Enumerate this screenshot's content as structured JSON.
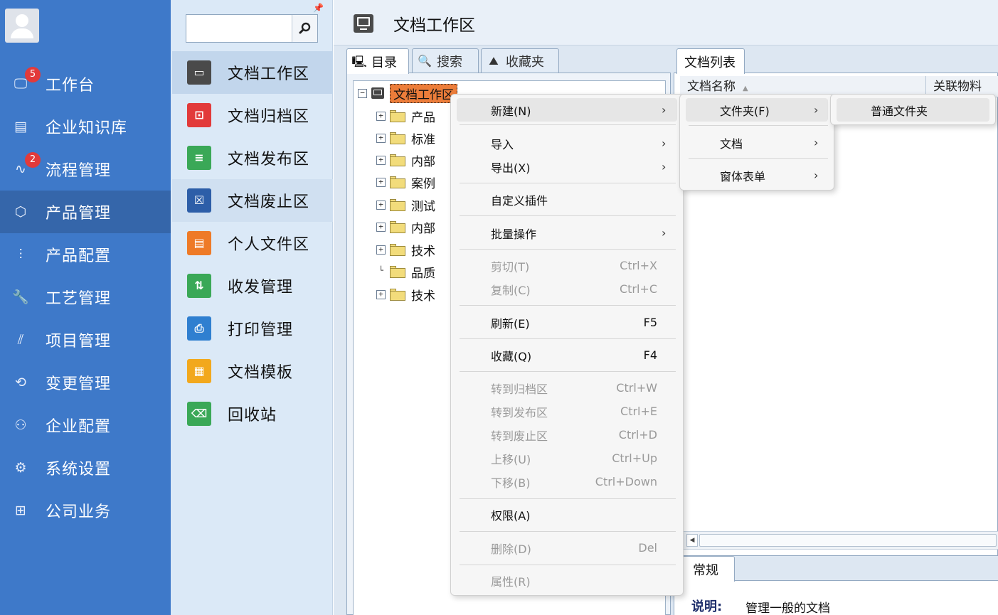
{
  "nav": {
    "items": [
      {
        "label": "工作台",
        "icon": "monitor-icon",
        "badge": "5"
      },
      {
        "label": "企业知识库",
        "icon": "knowledge-icon",
        "badge": ""
      },
      {
        "label": "流程管理",
        "icon": "process-icon",
        "badge": "2"
      },
      {
        "label": "产品管理",
        "icon": "cube-icon",
        "badge": ""
      },
      {
        "label": "产品配置",
        "icon": "sliders-icon",
        "badge": ""
      },
      {
        "label": "工艺管理",
        "icon": "wrench-icon",
        "badge": ""
      },
      {
        "label": "项目管理",
        "icon": "project-icon",
        "badge": ""
      },
      {
        "label": "变更管理",
        "icon": "change-icon",
        "badge": ""
      },
      {
        "label": "企业配置",
        "icon": "users-icon",
        "badge": ""
      },
      {
        "label": "系统设置",
        "icon": "gear-icon",
        "badge": ""
      },
      {
        "label": "公司业务",
        "icon": "grid-icon",
        "badge": ""
      }
    ],
    "active_index": 3
  },
  "subnav": {
    "search_value": "",
    "items": [
      {
        "label": "文档工作区",
        "color": "#4a4a4a",
        "glyph": "▭"
      },
      {
        "label": "文档归档区",
        "color": "#e23a3a",
        "glyph": "⊡"
      },
      {
        "label": "文档发布区",
        "color": "#3aa857",
        "glyph": "≡"
      },
      {
        "label": "文档废止区",
        "color": "#2d5ea8",
        "glyph": "☒"
      },
      {
        "label": "个人文件区",
        "color": "#ee7a27",
        "glyph": "▤"
      },
      {
        "label": "收发管理",
        "color": "#3aa857",
        "glyph": "⇅"
      },
      {
        "label": "打印管理",
        "color": "#2f7fd0",
        "glyph": "⎙"
      },
      {
        "label": "文档模板",
        "color": "#f2a81d",
        "glyph": "▦"
      },
      {
        "label": "回收站",
        "color": "#3aa857",
        "glyph": "⌫"
      }
    ]
  },
  "header": {
    "title": "文档工作区"
  },
  "tree_panel": {
    "tabs": [
      "目录",
      "搜索",
      "收藏夹"
    ],
    "root": "文档工作区",
    "nodes": [
      {
        "label": "产品",
        "expandable": true
      },
      {
        "label": "标准",
        "expandable": true
      },
      {
        "label": "内部",
        "expandable": true
      },
      {
        "label": "案例",
        "expandable": true
      },
      {
        "label": "测试",
        "expandable": true
      },
      {
        "label": "内部",
        "expandable": true
      },
      {
        "label": "技术",
        "expandable": true
      },
      {
        "label": "品质",
        "expandable": false
      },
      {
        "label": "技术",
        "expandable": true
      }
    ]
  },
  "list_panel": {
    "tab": "文档列表",
    "columns": [
      "文档名称",
      "关联物料"
    ]
  },
  "props": {
    "tab": "常规",
    "desc_key": "说明:",
    "desc_value": "管理一般的文档"
  },
  "context_menu": {
    "items": [
      {
        "label": "新建(N)",
        "shortcut": "",
        "submenu": true,
        "disabled": false
      },
      {
        "label": "导入",
        "shortcut": "",
        "submenu": true,
        "disabled": false
      },
      {
        "label": "导出(X)",
        "shortcut": "",
        "submenu": true,
        "disabled": false
      },
      {
        "label": "自定义插件",
        "shortcut": "",
        "submenu": false,
        "disabled": false
      },
      {
        "label": "批量操作",
        "shortcut": "",
        "submenu": true,
        "disabled": false
      },
      {
        "label": "剪切(T)",
        "shortcut": "Ctrl+X",
        "submenu": false,
        "disabled": true
      },
      {
        "label": "复制(C)",
        "shortcut": "Ctrl+C",
        "submenu": false,
        "disabled": true
      },
      {
        "label": "刷新(E)",
        "shortcut": "F5",
        "submenu": false,
        "disabled": false
      },
      {
        "label": "收藏(Q)",
        "shortcut": "F4",
        "submenu": false,
        "disabled": false
      },
      {
        "label": "转到归档区",
        "shortcut": "Ctrl+W",
        "submenu": false,
        "disabled": true
      },
      {
        "label": "转到发布区",
        "shortcut": "Ctrl+E",
        "submenu": false,
        "disabled": true
      },
      {
        "label": "转到废止区",
        "shortcut": "Ctrl+D",
        "submenu": false,
        "disabled": true
      },
      {
        "label": "上移(U)",
        "shortcut": "Ctrl+Up",
        "submenu": false,
        "disabled": true
      },
      {
        "label": "下移(B)",
        "shortcut": "Ctrl+Down",
        "submenu": false,
        "disabled": true
      },
      {
        "label": "权限(A)",
        "shortcut": "",
        "submenu": false,
        "disabled": false
      },
      {
        "label": "删除(D)",
        "shortcut": "Del",
        "submenu": false,
        "disabled": true
      },
      {
        "label": "属性(R)",
        "shortcut": "",
        "submenu": false,
        "disabled": true
      }
    ]
  },
  "submenu_new": {
    "items": [
      {
        "label": "文件夹(F)",
        "submenu": true
      },
      {
        "label": "文档",
        "submenu": true
      },
      {
        "label": "窗体表单",
        "submenu": true
      }
    ]
  },
  "submenu_folder": {
    "items": [
      {
        "label": "普通文件夹"
      }
    ]
  },
  "arrow_glyph": "›"
}
